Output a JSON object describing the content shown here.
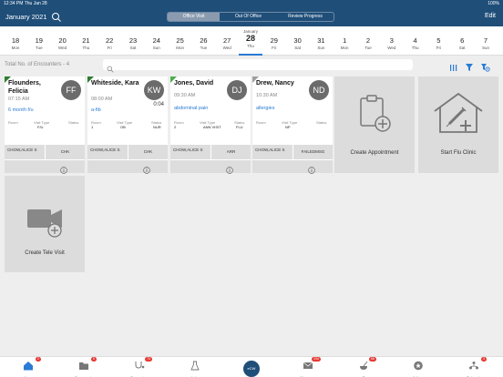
{
  "status_bar": {
    "time_date": "12:34 PM   Thu Jan 28",
    "right": "100%"
  },
  "header": {
    "month": "January 2021",
    "segments": [
      "Office Visit",
      "Out Of Office",
      "Review Progress Note"
    ],
    "active_segment": "Office Visit",
    "edit_label": "Edit",
    "colors": {
      "bar": "#1f4e79",
      "accent": "#2a7bd4"
    }
  },
  "dates": [
    {
      "num": "18",
      "dow": "Mon"
    },
    {
      "num": "19",
      "dow": "Tue"
    },
    {
      "num": "20",
      "dow": "Wed"
    },
    {
      "num": "21",
      "dow": "Thu"
    },
    {
      "num": "22",
      "dow": "Fri"
    },
    {
      "num": "23",
      "dow": "Sat"
    },
    {
      "num": "24",
      "dow": "Sun"
    },
    {
      "num": "25",
      "dow": "Mon"
    },
    {
      "num": "26",
      "dow": "Tue"
    },
    {
      "num": "27",
      "dow": "Wed"
    },
    {
      "num": "28",
      "dow": "Thu",
      "month": "January",
      "selected": true
    },
    {
      "num": "29",
      "dow": "Fri"
    },
    {
      "num": "30",
      "dow": "Sat"
    },
    {
      "num": "31",
      "dow": "Sun"
    },
    {
      "num": "1",
      "dow": "Mon"
    },
    {
      "num": "2",
      "dow": "Tue"
    },
    {
      "num": "3",
      "dow": "Wed"
    },
    {
      "num": "4",
      "dow": "Thu"
    },
    {
      "num": "5",
      "dow": "Fri"
    },
    {
      "num": "6",
      "dow": "Sat"
    },
    {
      "num": "7",
      "dow": "Sun"
    }
  ],
  "filter": {
    "total": "Total No. of Encounters - 4",
    "search_placeholder": ""
  },
  "encounters": [
    {
      "name": "Flounders, Felicia",
      "initials": "FF",
      "time": "07:15 AM",
      "duration": "",
      "reason": "6 month f/u",
      "headers": [
        "Room",
        "Visit Type",
        "Status"
      ],
      "room": "",
      "visit_type": "F/U",
      "status_code": "",
      "provider": "CHOW,ALICE S",
      "status": "CHK",
      "flag": "green"
    },
    {
      "name": "Whiteside, Kara",
      "initials": "KW",
      "time": "08:00 AM",
      "duration": "0:04",
      "reason": "a-fib",
      "headers": [
        "Room",
        "Visit Type",
        "Status"
      ],
      "room": "1",
      "visit_type": "OB",
      "status_code": "NUR",
      "provider": "CHOW,ALICE S",
      "status": "CHK",
      "flag": "green"
    },
    {
      "name": "Jones, David",
      "initials": "DJ",
      "time": "09:30 AM",
      "duration": "",
      "reason": "abdominal pain",
      "headers": [
        "Room",
        "Visit Type",
        "Status"
      ],
      "room": "2",
      "visit_type": "ANN VISIT",
      "status_code": "FLU",
      "provider": "CHOW,ALICE S",
      "status": "ARR",
      "flag": "lgreen"
    },
    {
      "name": "Drew, Nancy",
      "initials": "ND",
      "time": "10:30 AM",
      "duration": "",
      "reason": "allergies",
      "headers": [
        "Room",
        "Visit Type",
        "Status"
      ],
      "room": "",
      "visit_type": "NP",
      "status_code": "",
      "provider": "CHOW,ALICE S",
      "status": "FAILEDMSG",
      "flag": "grey"
    }
  ],
  "tiles": {
    "appointment": "Create Appointment",
    "flu": "Start Flu Clinic",
    "tele": "Create Tele Visit"
  },
  "tabs": [
    {
      "label": "Home",
      "icon": "home-icon",
      "badge": "2",
      "active": true
    },
    {
      "label": "Documents",
      "icon": "folder-icon",
      "badge": "5"
    },
    {
      "label": "Encounters",
      "icon": "stethoscope-icon",
      "badge": "73"
    },
    {
      "label": "Labs",
      "icon": "flask-icon",
      "badge": ""
    },
    {
      "label": "Messages",
      "icon": "mail-icon",
      "badge": "234"
    },
    {
      "label": "eRx",
      "icon": "rx-icon",
      "badge": "66"
    },
    {
      "label": "Actions",
      "icon": "star-icon",
      "badge": ""
    },
    {
      "label": "Referrals",
      "icon": "referral-icon",
      "badge": "3"
    }
  ],
  "center_button": "eCW"
}
